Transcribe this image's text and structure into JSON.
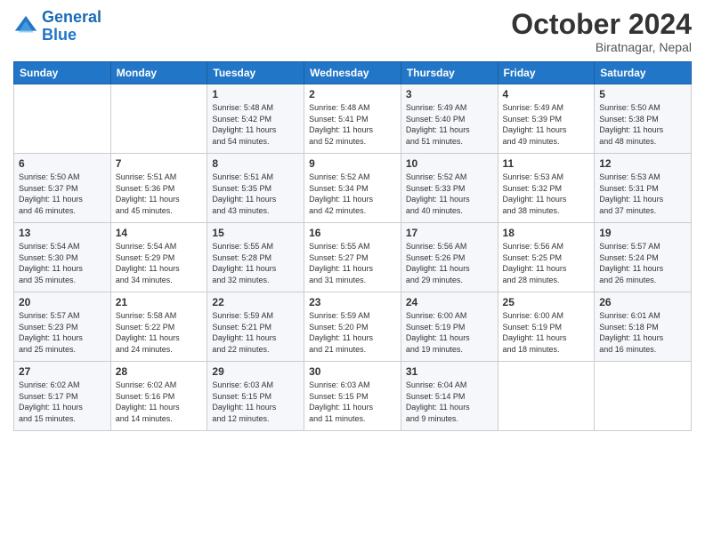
{
  "header": {
    "logo_line1": "General",
    "logo_line2": "Blue",
    "month": "October 2024",
    "location": "Biratnagar, Nepal"
  },
  "days_of_week": [
    "Sunday",
    "Monday",
    "Tuesday",
    "Wednesday",
    "Thursday",
    "Friday",
    "Saturday"
  ],
  "weeks": [
    [
      {
        "day": "",
        "info": ""
      },
      {
        "day": "",
        "info": ""
      },
      {
        "day": "1",
        "info": "Sunrise: 5:48 AM\nSunset: 5:42 PM\nDaylight: 11 hours\nand 54 minutes."
      },
      {
        "day": "2",
        "info": "Sunrise: 5:48 AM\nSunset: 5:41 PM\nDaylight: 11 hours\nand 52 minutes."
      },
      {
        "day": "3",
        "info": "Sunrise: 5:49 AM\nSunset: 5:40 PM\nDaylight: 11 hours\nand 51 minutes."
      },
      {
        "day": "4",
        "info": "Sunrise: 5:49 AM\nSunset: 5:39 PM\nDaylight: 11 hours\nand 49 minutes."
      },
      {
        "day": "5",
        "info": "Sunrise: 5:50 AM\nSunset: 5:38 PM\nDaylight: 11 hours\nand 48 minutes."
      }
    ],
    [
      {
        "day": "6",
        "info": "Sunrise: 5:50 AM\nSunset: 5:37 PM\nDaylight: 11 hours\nand 46 minutes."
      },
      {
        "day": "7",
        "info": "Sunrise: 5:51 AM\nSunset: 5:36 PM\nDaylight: 11 hours\nand 45 minutes."
      },
      {
        "day": "8",
        "info": "Sunrise: 5:51 AM\nSunset: 5:35 PM\nDaylight: 11 hours\nand 43 minutes."
      },
      {
        "day": "9",
        "info": "Sunrise: 5:52 AM\nSunset: 5:34 PM\nDaylight: 11 hours\nand 42 minutes."
      },
      {
        "day": "10",
        "info": "Sunrise: 5:52 AM\nSunset: 5:33 PM\nDaylight: 11 hours\nand 40 minutes."
      },
      {
        "day": "11",
        "info": "Sunrise: 5:53 AM\nSunset: 5:32 PM\nDaylight: 11 hours\nand 38 minutes."
      },
      {
        "day": "12",
        "info": "Sunrise: 5:53 AM\nSunset: 5:31 PM\nDaylight: 11 hours\nand 37 minutes."
      }
    ],
    [
      {
        "day": "13",
        "info": "Sunrise: 5:54 AM\nSunset: 5:30 PM\nDaylight: 11 hours\nand 35 minutes."
      },
      {
        "day": "14",
        "info": "Sunrise: 5:54 AM\nSunset: 5:29 PM\nDaylight: 11 hours\nand 34 minutes."
      },
      {
        "day": "15",
        "info": "Sunrise: 5:55 AM\nSunset: 5:28 PM\nDaylight: 11 hours\nand 32 minutes."
      },
      {
        "day": "16",
        "info": "Sunrise: 5:55 AM\nSunset: 5:27 PM\nDaylight: 11 hours\nand 31 minutes."
      },
      {
        "day": "17",
        "info": "Sunrise: 5:56 AM\nSunset: 5:26 PM\nDaylight: 11 hours\nand 29 minutes."
      },
      {
        "day": "18",
        "info": "Sunrise: 5:56 AM\nSunset: 5:25 PM\nDaylight: 11 hours\nand 28 minutes."
      },
      {
        "day": "19",
        "info": "Sunrise: 5:57 AM\nSunset: 5:24 PM\nDaylight: 11 hours\nand 26 minutes."
      }
    ],
    [
      {
        "day": "20",
        "info": "Sunrise: 5:57 AM\nSunset: 5:23 PM\nDaylight: 11 hours\nand 25 minutes."
      },
      {
        "day": "21",
        "info": "Sunrise: 5:58 AM\nSunset: 5:22 PM\nDaylight: 11 hours\nand 24 minutes."
      },
      {
        "day": "22",
        "info": "Sunrise: 5:59 AM\nSunset: 5:21 PM\nDaylight: 11 hours\nand 22 minutes."
      },
      {
        "day": "23",
        "info": "Sunrise: 5:59 AM\nSunset: 5:20 PM\nDaylight: 11 hours\nand 21 minutes."
      },
      {
        "day": "24",
        "info": "Sunrise: 6:00 AM\nSunset: 5:19 PM\nDaylight: 11 hours\nand 19 minutes."
      },
      {
        "day": "25",
        "info": "Sunrise: 6:00 AM\nSunset: 5:19 PM\nDaylight: 11 hours\nand 18 minutes."
      },
      {
        "day": "26",
        "info": "Sunrise: 6:01 AM\nSunset: 5:18 PM\nDaylight: 11 hours\nand 16 minutes."
      }
    ],
    [
      {
        "day": "27",
        "info": "Sunrise: 6:02 AM\nSunset: 5:17 PM\nDaylight: 11 hours\nand 15 minutes."
      },
      {
        "day": "28",
        "info": "Sunrise: 6:02 AM\nSunset: 5:16 PM\nDaylight: 11 hours\nand 14 minutes."
      },
      {
        "day": "29",
        "info": "Sunrise: 6:03 AM\nSunset: 5:15 PM\nDaylight: 11 hours\nand 12 minutes."
      },
      {
        "day": "30",
        "info": "Sunrise: 6:03 AM\nSunset: 5:15 PM\nDaylight: 11 hours\nand 11 minutes."
      },
      {
        "day": "31",
        "info": "Sunrise: 6:04 AM\nSunset: 5:14 PM\nDaylight: 11 hours\nand 9 minutes."
      },
      {
        "day": "",
        "info": ""
      },
      {
        "day": "",
        "info": ""
      }
    ]
  ]
}
